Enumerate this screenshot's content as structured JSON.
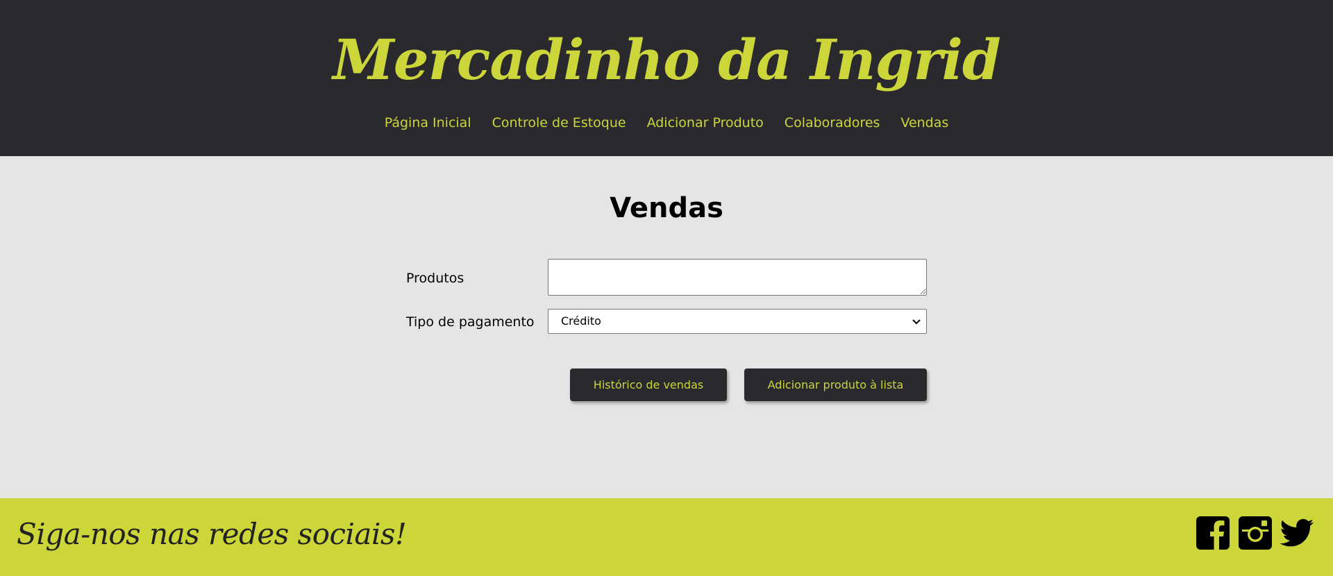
{
  "header": {
    "brand": "Mercadinho da Ingrid",
    "nav": [
      {
        "label": "Página Inicial"
      },
      {
        "label": "Controle de Estoque"
      },
      {
        "label": "Adicionar Produto"
      },
      {
        "label": "Colaboradores"
      },
      {
        "label": "Vendas"
      }
    ]
  },
  "main": {
    "title": "Vendas",
    "products_label": "Produtos",
    "products_value": "",
    "payment_label": "Tipo de pagamento",
    "payment_selected": "Crédito",
    "history_button": "Histórico de vendas",
    "add_button": "Adicionar produto à lista"
  },
  "footer": {
    "text": "Siga-nos nas redes sociais!",
    "social_icons": [
      "facebook-icon",
      "instagram-icon",
      "twitter-icon"
    ]
  },
  "colors": {
    "header_bg": "#29292e",
    "accent": "#ccd63a",
    "page_bg": "#e5e5e5",
    "footer_bg": "#ccd639"
  }
}
